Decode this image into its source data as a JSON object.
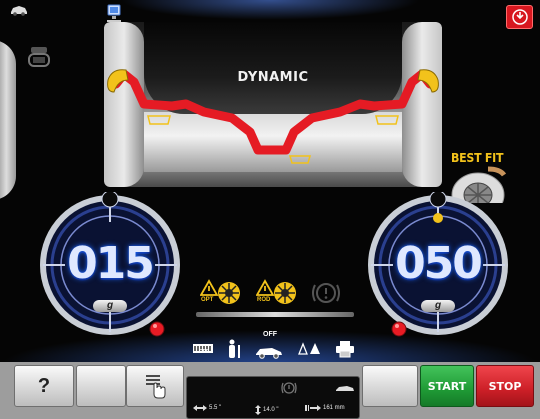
{
  "header": {
    "power_icon": "power-icon",
    "network_icon": "network-computer-icon",
    "top_left_icon": "car-icon"
  },
  "wheel_profile": {
    "mode_label": "DYNAMIC",
    "profile_color": "#e51b24",
    "clip_color": "#f2c21b"
  },
  "best_fit": {
    "label": "BEST FIT",
    "icon": "wheel-rotate-icon"
  },
  "gauges": {
    "left": {
      "value": "015",
      "unit": "g",
      "indicator_color": "#e81b24"
    },
    "right": {
      "value": "050",
      "unit": "g",
      "indicator_color": "#e81b24",
      "top_marker_color": "#f2c21b"
    }
  },
  "warnings": {
    "opt_label": "OPT",
    "rod_label": "ROD",
    "accent": "#f2c21b"
  },
  "status_strip": {
    "wm_label": "OFF",
    "mode_label": "OFF"
  },
  "buttons": {
    "help_label": "?",
    "start_label": "START",
    "stop_label": "STOP"
  },
  "info_box": {
    "distance": "5.5 \"",
    "diameter": "14.0 \"",
    "width": "161 mm"
  }
}
